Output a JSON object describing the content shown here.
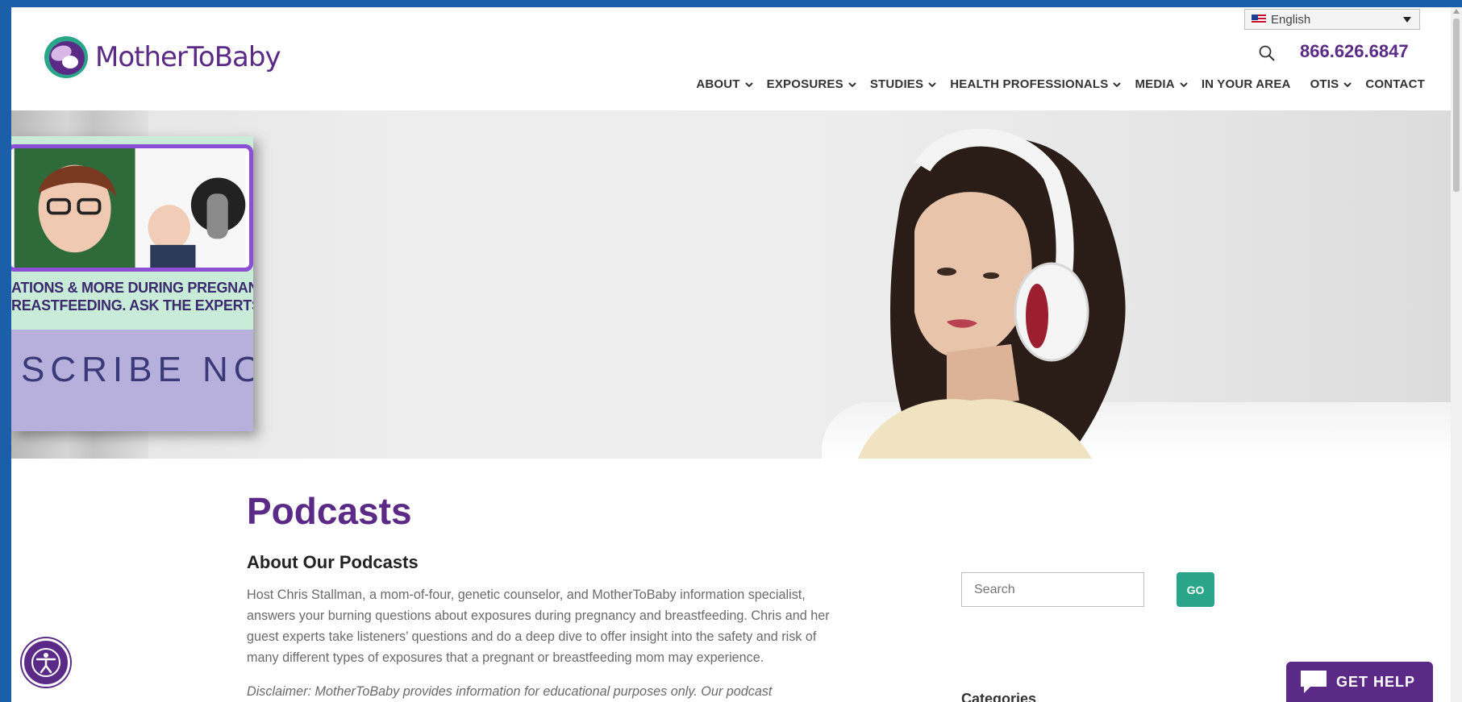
{
  "header": {
    "logo_text": "MotherToBaby",
    "language": "English",
    "phone": "866.626.6847"
  },
  "nav": {
    "items": [
      {
        "label": "ABOUT",
        "dropdown": true
      },
      {
        "label": "EXPOSURES",
        "dropdown": true
      },
      {
        "label": "STUDIES",
        "dropdown": true
      },
      {
        "label": "HEALTH PROFESSIONALS",
        "dropdown": true
      },
      {
        "label": "MEDIA",
        "dropdown": true
      },
      {
        "label": "IN YOUR AREA",
        "dropdown": false
      },
      {
        "label": "OTIS",
        "dropdown": true
      },
      {
        "label": "CONTACT",
        "dropdown": false
      }
    ]
  },
  "promo": {
    "line1": "ATIONS & MORE DURING PREGNANCY",
    "line2": "REASTFEEDING. ASK THE EXPERTS.",
    "cta": "SCRIBE NOW"
  },
  "main": {
    "title": "Podcasts",
    "subtitle": "About Our Podcasts",
    "paragraph": "Host Chris Stallman, a mom-of-four, genetic counselor, and MotherToBaby information specialist, answers your burning questions about exposures during pregnancy and breastfeeding. Chris and her guest experts take listeners’ questions and do a deep dive to offer insight into the safety and risk of many different types of exposures that a pregnant or breastfeeding mom may experience.",
    "disclaimer": "Disclaimer: MotherToBaby provides information for educational purposes only. Our podcast"
  },
  "sidebar": {
    "search_placeholder": "Search",
    "go_label": "GO",
    "categories_heading": "Categories"
  },
  "widgets": {
    "help_label": "GET HELP"
  },
  "colors": {
    "brand_purple": "#5b2a86",
    "go_green": "#2aa58a"
  }
}
